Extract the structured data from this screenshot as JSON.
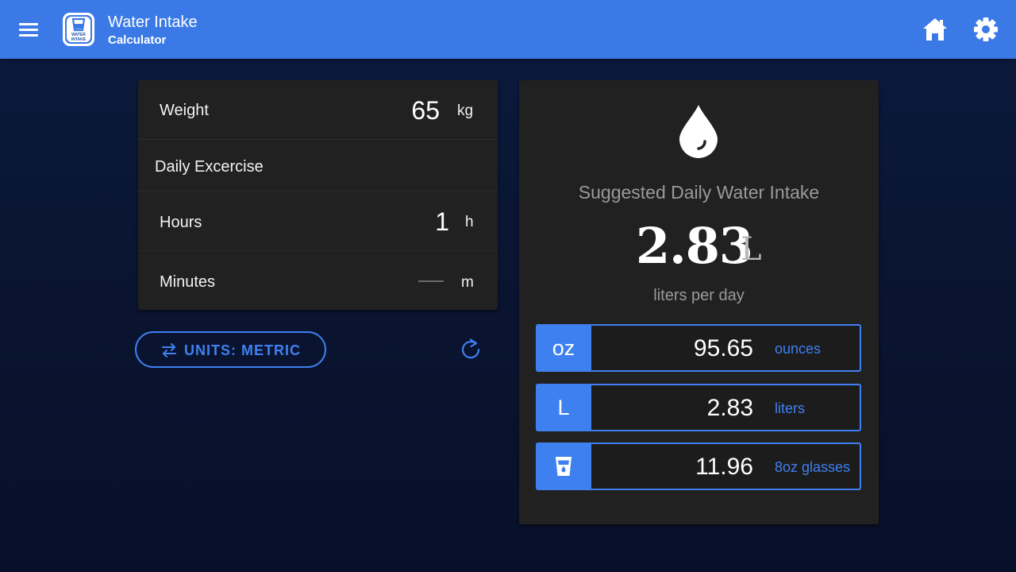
{
  "app": {
    "title_line1": "Water Intake",
    "title_line2": "Calculator",
    "logo_text": "WATER INTAKE",
    "accent_color": "#3b7ae6"
  },
  "toolbar": {
    "menu_icon": "menu-icon",
    "home_icon": "home-icon",
    "settings_icon": "gear-icon"
  },
  "inputs": {
    "weight": {
      "label": "Weight",
      "value": "65",
      "unit": "kg"
    },
    "exercise_header": "Daily Excercise",
    "hours": {
      "label": "Hours",
      "value": "1",
      "unit": "h"
    },
    "minutes": {
      "label": "Minutes",
      "value": "",
      "unit": "m"
    }
  },
  "controls": {
    "units_label": "UNITS: METRIC",
    "units_icon": "swap-icon",
    "refresh_icon": "refresh-icon"
  },
  "result": {
    "icon": "water-drop-icon",
    "title": "Suggested Daily Water Intake",
    "value": "2.83",
    "unit": "L",
    "subtitle": "liters per day",
    "conversions": [
      {
        "badge": "oz",
        "value": "95.65",
        "unit": "ounces"
      },
      {
        "badge": "L",
        "value": "2.83",
        "unit": "liters"
      },
      {
        "badge": "",
        "badge_icon": "glass-icon",
        "value": "11.96",
        "unit": "8oz glasses"
      }
    ]
  }
}
